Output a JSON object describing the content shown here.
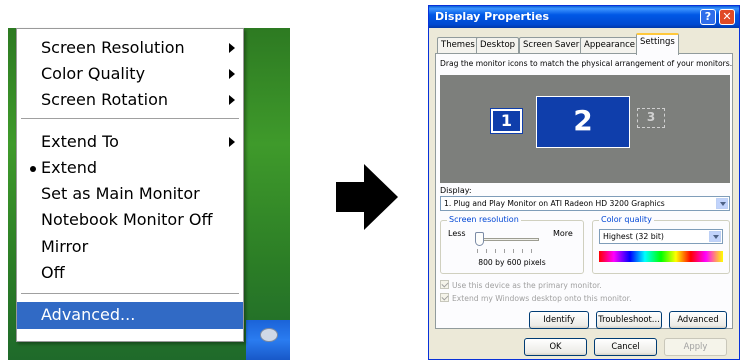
{
  "context_menu": {
    "items": [
      {
        "label": "Screen Resolution",
        "submenu": true
      },
      {
        "label": "Color Quality",
        "submenu": true
      },
      {
        "label": "Screen Rotation",
        "submenu": true
      },
      {
        "label": "Extend To",
        "submenu": true
      },
      {
        "label": "Extend",
        "checked": true
      },
      {
        "label": "Set as Main Monitor"
      },
      {
        "label": "Notebook Monitor Off"
      },
      {
        "label": "Mirror"
      },
      {
        "label": "Off"
      },
      {
        "label": "Advanced...",
        "selected": true
      }
    ],
    "selected_color": "#316ac5"
  },
  "dialog": {
    "title": "Display Properties",
    "help_glyph": "?",
    "close_glyph": "✕",
    "tabs": [
      "Themes",
      "Desktop",
      "Screen Saver",
      "Appearance",
      "Settings"
    ],
    "active_tab": "Settings",
    "instruction": "Drag the monitor icons to match the physical arrangement of your monitors.",
    "monitors": [
      "1",
      "2",
      "3"
    ],
    "display_label": "Display:",
    "display_value": "1. Plug and Play Monitor on ATI Radeon HD 3200 Graphics",
    "screen_resolution": {
      "legend": "Screen resolution",
      "less": "Less",
      "more": "More",
      "value": "800 by 600 pixels",
      "slider_fraction": 0
    },
    "color_quality": {
      "legend": "Color quality",
      "value": "Highest (32 bit)"
    },
    "checkboxes": [
      {
        "label": "Use this device as the primary monitor.",
        "checked": true,
        "enabled": false
      },
      {
        "label": "Extend my Windows desktop onto this monitor.",
        "checked": true,
        "enabled": false
      }
    ],
    "buttons": {
      "identify": "Identify",
      "troubleshoot": "Troubleshoot...",
      "advanced": "Advanced",
      "ok": "OK",
      "cancel": "Cancel",
      "apply": "Apply"
    },
    "titlebar_color": "#0058e6"
  },
  "arrow_icon": "right-arrow-icon"
}
